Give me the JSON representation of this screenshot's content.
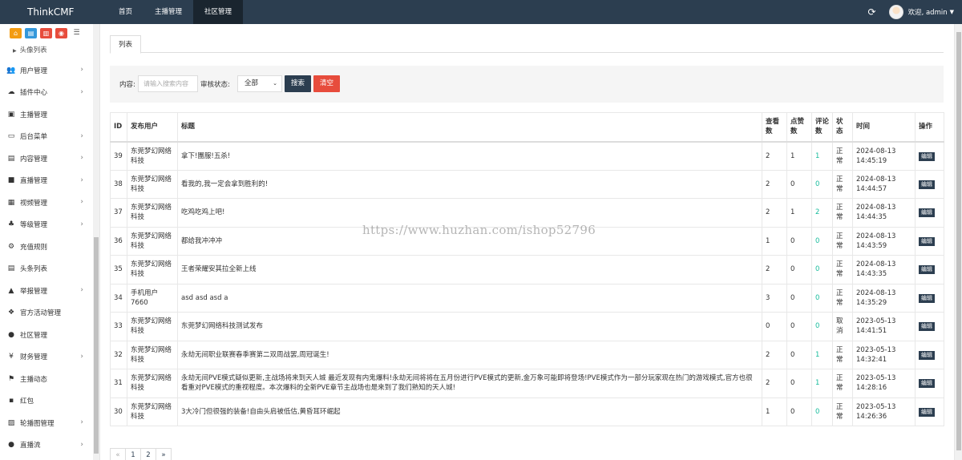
{
  "topbar": {
    "brand": "ThinkCMF",
    "nav": [
      "首页",
      "主播管理",
      "社区管理"
    ],
    "welcome": "欢迎, admin"
  },
  "sidebar": {
    "sub_item": "头像列表",
    "items": [
      {
        "label": "用户管理",
        "icon": "users-icon",
        "arrow": true
      },
      {
        "label": "插件中心",
        "icon": "cloud-icon",
        "arrow": true
      },
      {
        "label": "主播管理",
        "icon": "id-card-icon",
        "arrow": false
      },
      {
        "label": "后台菜单",
        "icon": "desktop-icon",
        "arrow": true
      },
      {
        "label": "内容管理",
        "icon": "archive-icon",
        "arrow": true
      },
      {
        "label": "直播管理",
        "icon": "video-icon",
        "arrow": true
      },
      {
        "label": "视频管理",
        "icon": "film-icon",
        "arrow": true
      },
      {
        "label": "等级管理",
        "icon": "sitemap-icon",
        "arrow": true
      },
      {
        "label": "充值规则",
        "icon": "cogs-icon",
        "arrow": false
      },
      {
        "label": "头条列表",
        "icon": "newspaper-icon",
        "arrow": false
      },
      {
        "label": "举报管理",
        "icon": "warning-icon",
        "arrow": true
      },
      {
        "label": "官方活动管理",
        "icon": "cubes-icon",
        "arrow": false
      },
      {
        "label": "社区管理",
        "icon": "comment-icon",
        "arrow": false
      },
      {
        "label": "财务管理",
        "icon": "yen-icon",
        "arrow": true
      },
      {
        "label": "主播动态",
        "icon": "flag-icon",
        "arrow": false
      },
      {
        "label": "红包",
        "icon": "envelope-icon",
        "arrow": false
      },
      {
        "label": "轮播图管理",
        "icon": "image-icon",
        "arrow": true
      },
      {
        "label": "直播流",
        "icon": "tint-icon",
        "arrow": true
      }
    ]
  },
  "tabs": [
    "列表"
  ],
  "search": {
    "content_label": "内容:",
    "content_placeholder": "请输入搜索内容",
    "status_label": "审核状态:",
    "status_value": "全部",
    "search_button": "搜索",
    "clear_button": "清空"
  },
  "table": {
    "headers": [
      "ID",
      "发布用户",
      "标题",
      "查看数",
      "点赞数",
      "评论数",
      "状态",
      "时间",
      "操作"
    ],
    "edit_label": "编辑",
    "rows": [
      {
        "id": "39",
        "user": "东莞梦幻网络科技",
        "title": "拿下!團服!五杀!",
        "views": "2",
        "likes": "1",
        "comments": "1",
        "status": "正常",
        "time": "2024-08-13 14:45:19"
      },
      {
        "id": "38",
        "user": "东莞梦幻网络科技",
        "title": "看我的,我一定会拿到胜利的!",
        "views": "2",
        "likes": "0",
        "comments": "0",
        "status": "正常",
        "time": "2024-08-13 14:44:57"
      },
      {
        "id": "37",
        "user": "东莞梦幻网络科技",
        "title": "吃鸡吃鸡上吧!",
        "views": "2",
        "likes": "1",
        "comments": "2",
        "status": "正常",
        "time": "2024-08-13 14:44:35"
      },
      {
        "id": "36",
        "user": "东莞梦幻网络科技",
        "title": "都给我冲冲冲",
        "views": "1",
        "likes": "0",
        "comments": "0",
        "status": "正常",
        "time": "2024-08-13 14:43:59"
      },
      {
        "id": "35",
        "user": "东莞梦幻网络科技",
        "title": "王者荣耀安其拉全新上线",
        "views": "2",
        "likes": "0",
        "comments": "0",
        "status": "正常",
        "time": "2024-08-13 14:43:35"
      },
      {
        "id": "34",
        "user": "手机用户7660",
        "title": "asd asd asd a",
        "views": "3",
        "likes": "0",
        "comments": "0",
        "status": "正常",
        "time": "2024-08-13 14:35:29"
      },
      {
        "id": "33",
        "user": "东莞梦幻网络科技",
        "title": "东莞梦幻网络科技测试发布",
        "views": "0",
        "likes": "0",
        "comments": "0",
        "status": "取消",
        "time": "2023-05-13 14:41:51"
      },
      {
        "id": "32",
        "user": "东莞梦幻网络科技",
        "title": "永劫无间职业联赛春季赛第二双周战罢,周冠诞生!",
        "views": "2",
        "likes": "0",
        "comments": "1",
        "status": "正常",
        "time": "2023-05-13 14:32:41"
      },
      {
        "id": "31",
        "user": "东莞梦幻网络科技",
        "title": "永劫无间PVE模式疑似更新,主战场将来到天人城 最近发现有内鬼爆料!永劫无间将将在五月份进行PVE模式的更新,金万象可能即将登场!PVE模式作为一部分玩家现在热门的游戏模式,官方也很看重对PVE模式的重视程度。本次爆料的全新PVE章节主战场也是来到了我们熟知的天人城!",
        "views": "2",
        "likes": "0",
        "comments": "1",
        "status": "正常",
        "time": "2023-05-13 14:28:16"
      },
      {
        "id": "30",
        "user": "东莞梦幻网络科技",
        "title": "3大冷门但很强的装备!自由头肩被低估,黄昏耳环崛起",
        "views": "1",
        "likes": "0",
        "comments": "0",
        "status": "正常",
        "time": "2023-05-13 14:26:36"
      }
    ]
  },
  "pagination": [
    "«",
    "1",
    "2",
    "»"
  ],
  "watermark": "https://www.huzhan.com/ishop52796"
}
